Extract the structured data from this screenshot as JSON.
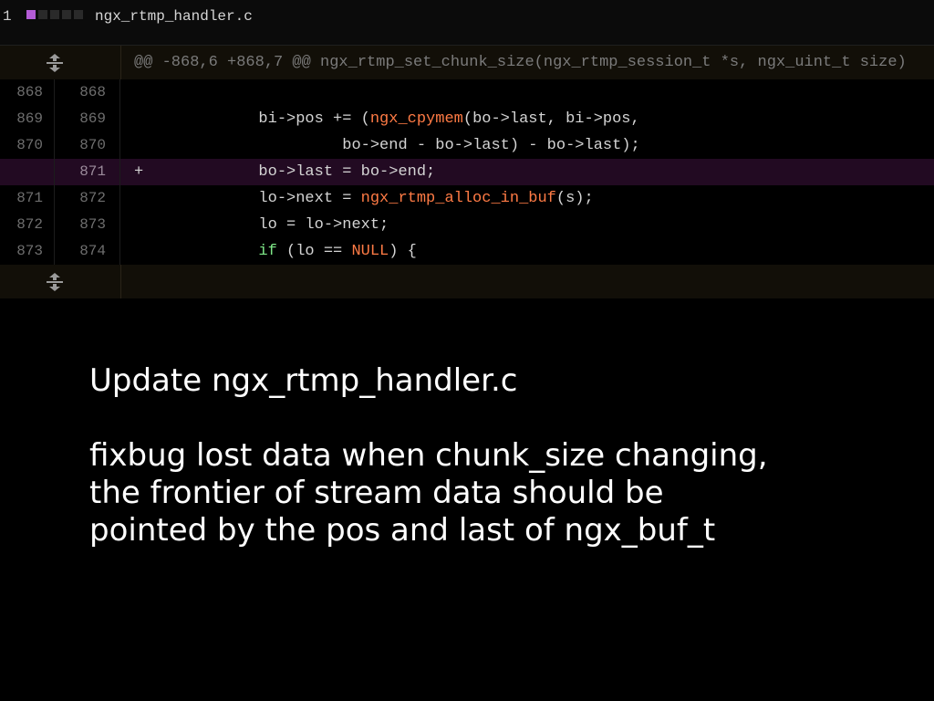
{
  "file": {
    "count": "1",
    "name": "ngx_rtmp_handler.c",
    "stat_colors": [
      "#b45cd6",
      "#2a2a2a",
      "#2a2a2a",
      "#2a2a2a",
      "#2a2a2a"
    ]
  },
  "hunk": {
    "header": "@@ -868,6 +868,7 @@ ngx_rtmp_set_chunk_size(ngx_rtmp_session_t *s, ngx_uint_t size)",
    "expand_icon": "expand-icon"
  },
  "lines": [
    {
      "old": "868",
      "new": "868",
      "sign": " ",
      "pre": "",
      "seg": "",
      "post": "",
      "indent": ""
    },
    {
      "old": "869",
      "new": "869",
      "sign": " ",
      "indent": "            ",
      "pre": "bi->pos += (",
      "fn": "ngx_cpymem",
      "post": "(bo->last, bi->pos,"
    },
    {
      "old": "870",
      "new": "870",
      "sign": " ",
      "indent": "                     ",
      "pre": "bo->end - bo->last) - bo->last);",
      "fn": "",
      "post": ""
    },
    {
      "old": "",
      "new": "871",
      "sign": "+",
      "indent": "            ",
      "pre": "bo->last = bo->end;",
      "fn": "",
      "post": ""
    },
    {
      "old": "871",
      "new": "872",
      "sign": " ",
      "indent": "            ",
      "pre": "lo->next = ",
      "fn": "ngx_rtmp_alloc_in_buf",
      "post": "(s);"
    },
    {
      "old": "872",
      "new": "873",
      "sign": " ",
      "indent": "            ",
      "pre": "lo = lo->next;",
      "fn": "",
      "post": ""
    },
    {
      "old": "873",
      "new": "874",
      "sign": " ",
      "indent": "            ",
      "kw": "if",
      "pre": " (lo == ",
      "cst": "NULL",
      "post": ") {"
    }
  ],
  "commit": {
    "title": "Update ngx_rtmp_handler.c",
    "body": [
      "fixbug lost data when chunk_size changing,",
      "the frontier of stream data should be",
      "pointed by the pos and last of ngx_buf_t"
    ]
  },
  "colors": {
    "added_bg": "#220a22",
    "keyword": "#7ee787",
    "function": "#ff7b45"
  }
}
